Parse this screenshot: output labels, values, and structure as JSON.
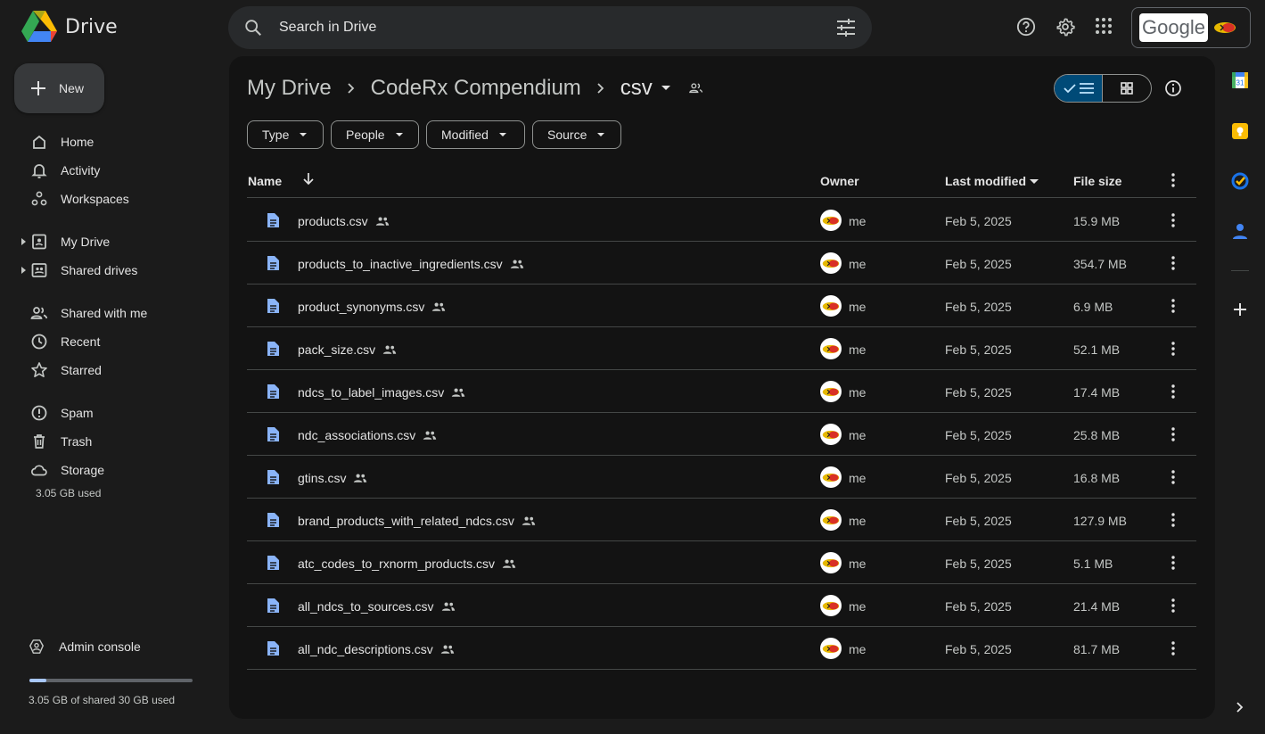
{
  "app": {
    "name": "Drive"
  },
  "search": {
    "placeholder": "Search in Drive"
  },
  "account": {
    "logo_text": "Google"
  },
  "sidebar": {
    "new_label": "New",
    "items": [
      {
        "label": "Home",
        "icon": "home-icon"
      },
      {
        "label": "Activity",
        "icon": "bell-icon"
      },
      {
        "label": "Workspaces",
        "icon": "workspaces-icon"
      },
      {
        "label": "My Drive",
        "icon": "my-drive-icon"
      },
      {
        "label": "Shared drives",
        "icon": "shared-drives-icon"
      },
      {
        "label": "Shared with me",
        "icon": "people-icon"
      },
      {
        "label": "Recent",
        "icon": "clock-icon"
      },
      {
        "label": "Starred",
        "icon": "star-icon"
      },
      {
        "label": "Spam",
        "icon": "spam-icon"
      },
      {
        "label": "Trash",
        "icon": "trash-icon"
      },
      {
        "label": "Storage",
        "icon": "cloud-icon"
      }
    ],
    "storage_used": "3.05 GB used",
    "admin_label": "Admin console",
    "storage_bar_fraction": 0.1017,
    "storage_bar_text": "3.05 GB of shared 30 GB used"
  },
  "breadcrumb": {
    "root": "My Drive",
    "parent": "CodeRx Compendium",
    "current": "csv"
  },
  "filters": [
    "Type",
    "People",
    "Modified",
    "Source"
  ],
  "table": {
    "headers": {
      "name": "Name",
      "owner": "Owner",
      "modified": "Last modified",
      "size": "File size"
    },
    "rows": [
      {
        "name": "products.csv",
        "owner": "me",
        "modified": "Feb 5, 2025",
        "size": "15.9 MB"
      },
      {
        "name": "products_to_inactive_ingredients.csv",
        "owner": "me",
        "modified": "Feb 5, 2025",
        "size": "354.7 MB"
      },
      {
        "name": "product_synonyms.csv",
        "owner": "me",
        "modified": "Feb 5, 2025",
        "size": "6.9 MB"
      },
      {
        "name": "pack_size.csv",
        "owner": "me",
        "modified": "Feb 5, 2025",
        "size": "52.1 MB"
      },
      {
        "name": "ndcs_to_label_images.csv",
        "owner": "me",
        "modified": "Feb 5, 2025",
        "size": "17.4 MB"
      },
      {
        "name": "ndc_associations.csv",
        "owner": "me",
        "modified": "Feb 5, 2025",
        "size": "25.8 MB"
      },
      {
        "name": "gtins.csv",
        "owner": "me",
        "modified": "Feb 5, 2025",
        "size": "16.8 MB"
      },
      {
        "name": "brand_products_with_related_ndcs.csv",
        "owner": "me",
        "modified": "Feb 5, 2025",
        "size": "127.9 MB"
      },
      {
        "name": "atc_codes_to_rxnorm_products.csv",
        "owner": "me",
        "modified": "Feb 5, 2025",
        "size": "5.1 MB"
      },
      {
        "name": "all_ndcs_to_sources.csv",
        "owner": "me",
        "modified": "Feb 5, 2025",
        "size": "21.4 MB"
      },
      {
        "name": "all_ndc_descriptions.csv",
        "owner": "me",
        "modified": "Feb 5, 2025",
        "size": "81.7 MB"
      }
    ]
  },
  "right_rail": {
    "calendar_day": "31",
    "apps": [
      "calendar-icon",
      "keep-icon",
      "tasks-icon",
      "contacts-icon",
      "add-icon",
      "expand-icon"
    ]
  },
  "colors": {
    "background": "#1b1b1b",
    "panel": "#131313",
    "accent": "#a8c7fa",
    "toggle_active": "#004a77",
    "doc_icon": "#8ab4f8"
  }
}
